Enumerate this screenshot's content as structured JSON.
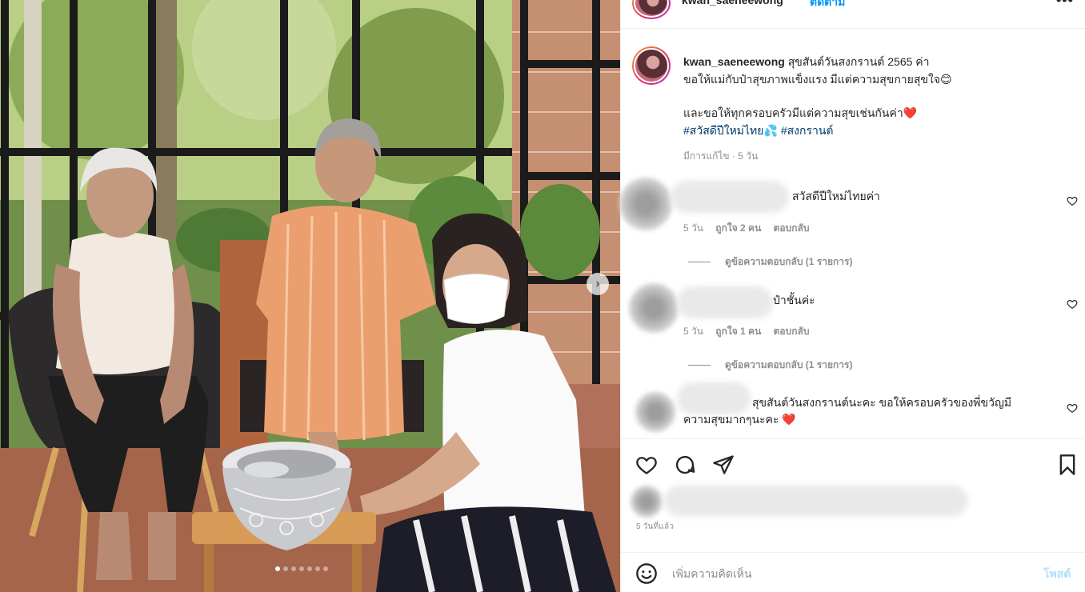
{
  "post": {
    "username": "kwan_saeneewong",
    "follow_label": "ติดตาม",
    "more_label": "•••",
    "carousel_total": 7,
    "carousel_current": 1
  },
  "caption": {
    "username": "kwan_saeneewong",
    "line1": "สุขสันต์วันสงกรานต์ 2565 ค่า",
    "line2": "ขอให้แม่กับป๋าสุขภาพแข็งแรง มีแต่ความสุขกายสุขใจ😊",
    "line3": "และขอให้ทุกครอบครัวมีแต่ความสุขเช่นกันค่า❤️",
    "hashtag1": "#สวัสดีปีใหม่ไทย",
    "hashtag_emoji": "💦",
    "hashtag2": "#สงกรานต์",
    "meta": "มีการแก้ไข · 5 วัน"
  },
  "comments": [
    {
      "text": "สวัสดีปีใหม่ไทยค่า",
      "time": "5 วัน",
      "likes": "ถูกใจ 2 คน",
      "reply": "ตอบกลับ",
      "view_replies": "ดูข้อความตอบกลับ (1 รายการ)"
    },
    {
      "text": "ป๋าชั้นค่ะ",
      "time": "5 วัน",
      "likes": "ถูกใจ 1 คน",
      "reply": "ตอบกลับ",
      "view_replies": "ดูข้อความตอบกลับ (1 รายการ)"
    },
    {
      "text_line1": "สุขสันต์วันสงกรานต์นะคะ ขอให้ครอบครัวของพี่ขวัญมี",
      "text_line2": "ความสุขมากๆนะคะ ❤️"
    }
  ],
  "timeago": "5 วันที่แล้ว",
  "add_comment": {
    "placeholder": "เพิ่มความคิดเห็น",
    "post_label": "โพสต์"
  },
  "icons": {
    "next": "chevron-right-icon",
    "like": "heart-icon",
    "comment": "comment-icon",
    "share": "paper-plane-icon",
    "save": "bookmark-icon",
    "emoji": "smiley-icon"
  },
  "colors": {
    "link": "#0095f6",
    "hashtag": "#00376b",
    "muted": "#8e8e8e",
    "heart": "#ed4956"
  }
}
